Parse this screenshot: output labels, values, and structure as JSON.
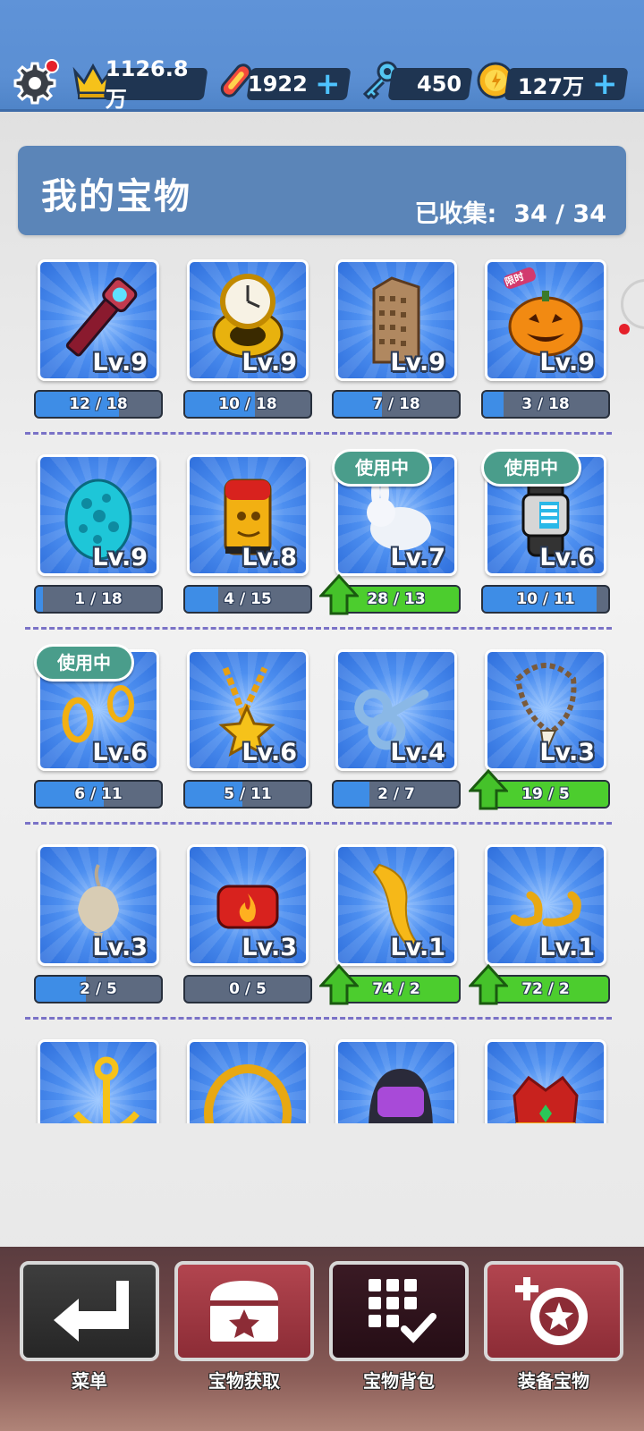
{
  "topbar": {
    "settings_icon": "gear-icon",
    "crown_value": "1126.8万",
    "board_value": "1922",
    "key_value": "450",
    "coin_value": "127万",
    "plus": "+"
  },
  "header": {
    "title": "我的宝物",
    "collected_label": "已收集:",
    "collected_value": "34 / 34"
  },
  "items": [
    {
      "name": "magic-wand",
      "level": "Lv.9",
      "progress": "12 / 18",
      "ratio": 0.667
    },
    {
      "name": "clock-ring",
      "level": "Lv.9",
      "progress": "10 / 18",
      "ratio": 0.556
    },
    {
      "name": "skyscraper",
      "level": "Lv.9",
      "progress": "7 / 18",
      "ratio": 0.389
    },
    {
      "name": "pumpkin",
      "level": "Lv.9",
      "progress": "3 / 18",
      "ratio": 0.167,
      "badge": "限时"
    },
    {
      "name": "cyan-egg",
      "level": "Lv.9",
      "progress": "1 / 18",
      "ratio": 0.056
    },
    {
      "name": "golden-idol-cup",
      "level": "Lv.8",
      "progress": "4 / 15",
      "ratio": 0.267
    },
    {
      "name": "white-rabbit",
      "level": "Lv.7",
      "progress": "28 / 13",
      "ratio": 1,
      "in_use": "使用中",
      "upgrade": true
    },
    {
      "name": "smart-watch",
      "level": "Lv.6",
      "progress": "10 / 11",
      "ratio": 0.909,
      "in_use": "使用中"
    },
    {
      "name": "gold-earrings",
      "level": "Lv.6",
      "progress": "6 / 11",
      "ratio": 0.545,
      "in_use": "使用中"
    },
    {
      "name": "star-necklace",
      "level": "Lv.6",
      "progress": "5 / 11",
      "ratio": 0.455
    },
    {
      "name": "wind-up-key",
      "level": "Lv.4",
      "progress": "2 / 7",
      "ratio": 0.286
    },
    {
      "name": "tooth-necklace",
      "level": "Lv.3",
      "progress": "19 / 5",
      "ratio": 1,
      "upgrade": true
    },
    {
      "name": "garlic-pendant",
      "level": "Lv.3",
      "progress": "2 / 5",
      "ratio": 0.4
    },
    {
      "name": "fire-ring",
      "level": "Lv.3",
      "progress": "0 / 5",
      "ratio": 0
    },
    {
      "name": "golden-feather",
      "level": "Lv.1",
      "progress": "74 / 2",
      "ratio": 1,
      "upgrade": true
    },
    {
      "name": "golden-horns",
      "level": "Lv.1",
      "progress": "72 / 2",
      "ratio": 1,
      "upgrade": true
    },
    {
      "name": "anchor",
      "level": "",
      "progress": "",
      "ratio": 0
    },
    {
      "name": "gold-ring",
      "level": "",
      "progress": "",
      "ratio": 0
    },
    {
      "name": "helmet",
      "level": "",
      "progress": "",
      "ratio": 0
    },
    {
      "name": "crown",
      "level": "",
      "progress": "",
      "ratio": 0
    }
  ],
  "nav": {
    "menu": "菜单",
    "treasure_get": "宝物获取",
    "treasure_bag": "宝物背包",
    "equip_treasure": "装备宝物"
  },
  "colors": {
    "topbar": "#5f93d8",
    "header": "#5b85b8",
    "progress_fill": "#3e8de6",
    "progress_full": "#4ccd2e",
    "in_use_badge": "#4a9d8b"
  }
}
